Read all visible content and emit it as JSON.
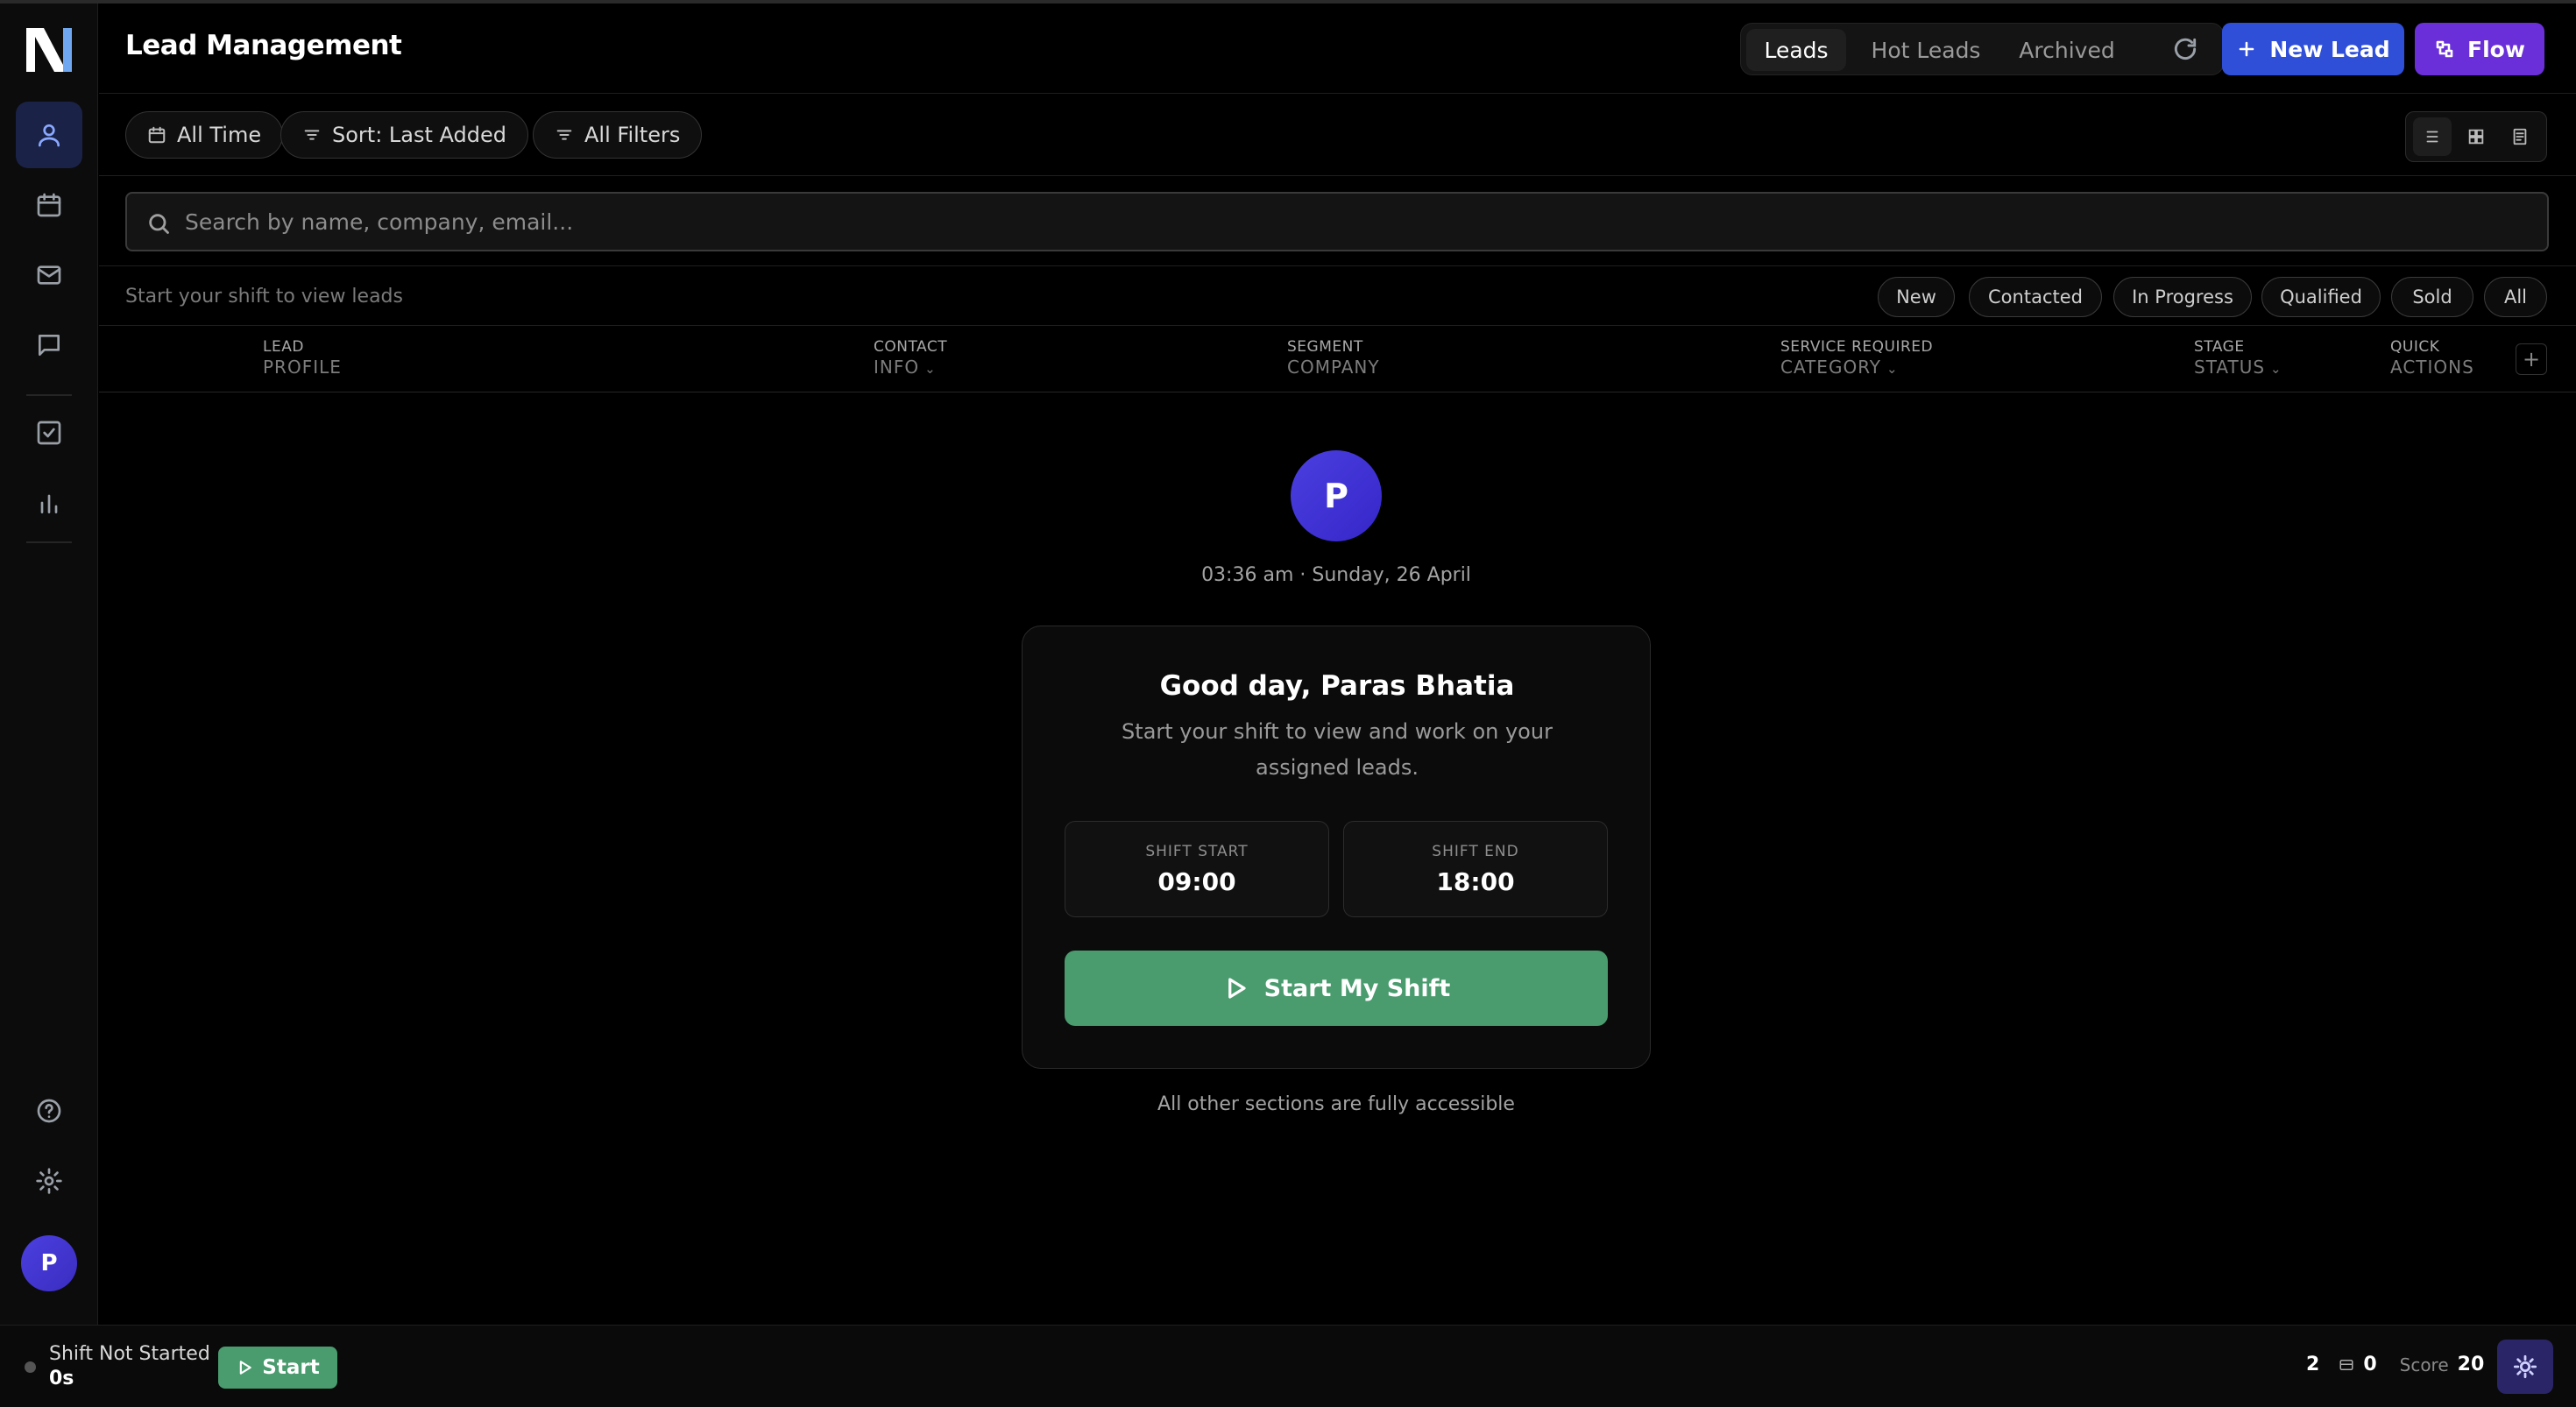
{
  "header": {
    "title": "Lead Management",
    "tabs": [
      {
        "label": "Leads",
        "active": true
      },
      {
        "label": "Hot Leads",
        "active": false
      },
      {
        "label": "Archived",
        "active": false
      }
    ],
    "new_lead_label": "New Lead",
    "flow_label": "Flow"
  },
  "sidebar": {
    "logo_text": "N",
    "nav": [
      "user-icon",
      "calendar-icon",
      "mail-icon",
      "chat-icon",
      "checkbox-icon",
      "bar-chart-icon"
    ],
    "bottom": [
      "help-icon",
      "settings-icon"
    ],
    "avatar_initial": "P"
  },
  "filters": {
    "time": "All Time",
    "sort": "Sort: Last Added",
    "all": "All Filters"
  },
  "search": {
    "placeholder": "Search by name, company, email..."
  },
  "status_row": {
    "hint": "Start your shift to view leads",
    "chips": [
      "New",
      "Contacted",
      "In Progress",
      "Qualified",
      "Sold",
      "All"
    ]
  },
  "table": {
    "columns": [
      {
        "top": "LEAD",
        "bottom": "PROFILE"
      },
      {
        "top": "CONTACT",
        "bottom": "INFO"
      },
      {
        "top": "SEGMENT",
        "bottom": "COMPANY"
      },
      {
        "top": "SERVICE REQUIRED",
        "bottom": "CATEGORY"
      },
      {
        "top": "STAGE",
        "bottom": "STATUS"
      },
      {
        "top": "QUICK",
        "bottom": "ACTIONS"
      }
    ],
    "add_column": "+"
  },
  "main": {
    "avatar_initial": "P",
    "datetime": "03:36 am · Sunday, 26 April",
    "greeting": "Good day, Paras Bhatia",
    "subtext": "Start your shift to view and work on your assigned leads.",
    "shift_start_label": "SHIFT START",
    "shift_start_value": "09:00",
    "shift_end_label": "SHIFT END",
    "shift_end_value": "18:00",
    "start_button": "Start My Shift",
    "footnote": "All other sections are fully accessible"
  },
  "bottombar": {
    "status": "Shift Not Started",
    "elapsed": "0s",
    "start_label": "Start",
    "count_1": "2",
    "count_2": "0",
    "score_label": "Score",
    "score_value": "20"
  },
  "colors": {
    "primary_blue": "#2f4fd8",
    "flow_purple": "#6a2fd8",
    "start_green": "#4a9b6e",
    "avatar_indigo": "#4b3fe0"
  }
}
